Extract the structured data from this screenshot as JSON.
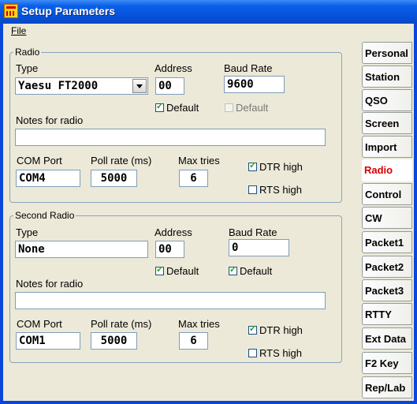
{
  "window": {
    "title": "Setup Parameters"
  },
  "menu": {
    "file": "File"
  },
  "radio1": {
    "group_label": "Radio",
    "type_label": "Type",
    "type_value": "Yaesu FT2000",
    "address_label": "Address",
    "address_value": "00",
    "baud_label": "Baud Rate",
    "baud_value": "9600",
    "address_default_label": "Default",
    "address_default_checked": true,
    "baud_default_label": "Default",
    "baud_default_checked": false,
    "notes_label": "Notes for radio",
    "notes_value": "",
    "com_label": "COM Port",
    "com_value": "COM4",
    "poll_label": "Poll rate (ms)",
    "poll_value": "5000",
    "tries_label": "Max tries",
    "tries_value": "6",
    "dtr_label": "DTR high",
    "dtr_checked": true,
    "rts_label": "RTS high",
    "rts_checked": false
  },
  "radio2": {
    "group_label": "Second Radio",
    "type_label": "Type",
    "type_value": "None",
    "address_label": "Address",
    "address_value": "00",
    "baud_label": "Baud Rate",
    "baud_value": "0",
    "address_default_label": "Default",
    "address_default_checked": true,
    "baud_default_label": "Default",
    "baud_default_checked": true,
    "notes_label": "Notes for radio",
    "notes_value": "",
    "com_label": "COM Port",
    "com_value": "COM1",
    "poll_label": "Poll rate (ms)",
    "poll_value": "5000",
    "tries_label": "Max tries",
    "tries_value": "6",
    "dtr_label": "DTR high",
    "dtr_checked": true,
    "rts_label": "RTS high",
    "rts_checked": false
  },
  "tabs": [
    "Personal",
    "Station",
    "QSO",
    "Screen",
    "Import",
    "Radio",
    "Control",
    "CW",
    "Packet1",
    "Packet2",
    "Packet3",
    "RTTY",
    "Ext Data",
    "F2 Key",
    "Rep/Lab"
  ],
  "selected_tab": "Radio",
  "colors": {
    "titlebar": "#0552d8",
    "selected_tab_text": "#d40000",
    "face": "#ece9d8"
  }
}
